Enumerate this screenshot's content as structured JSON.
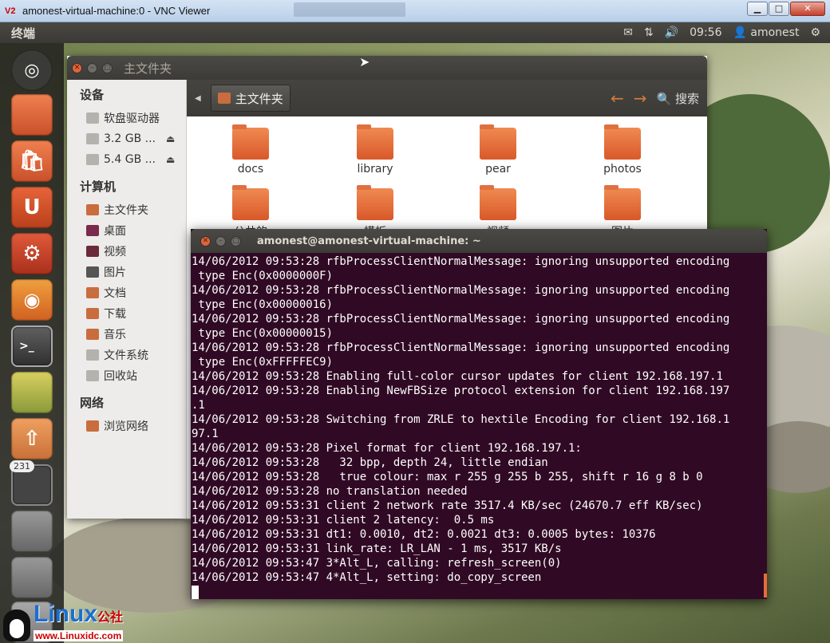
{
  "vnc": {
    "title": "amonest-virtual-machine:0 - VNC Viewer",
    "logo": "V2",
    "minimize": "▁",
    "maximize": "□",
    "close": "✕"
  },
  "panel": {
    "app_name": "终端",
    "time": "09:56",
    "user": "amonest",
    "icons": [
      "mail-icon",
      "network-icon",
      "volume-icon",
      "gear-icon"
    ]
  },
  "launcher": {
    "badge": "231",
    "items": [
      "dash",
      "home-folder",
      "software-center",
      "ubuntu-one",
      "system-settings",
      "firefox",
      "terminal",
      "disk-utility",
      "update-manager",
      "workspace-switcher",
      "drive",
      "drive",
      "trash"
    ]
  },
  "nautilus": {
    "title": "主文件夹",
    "crumb": "主文件夹",
    "search": "搜索",
    "devices_heading": "设备",
    "devices": [
      {
        "label": "软盘驱动器",
        "eject": false
      },
      {
        "label": "3.2 GB ...",
        "eject": true
      },
      {
        "label": "5.4 GB ...",
        "eject": true
      }
    ],
    "computer_heading": "计算机",
    "computer": [
      "主文件夹",
      "桌面",
      "视频",
      "图片",
      "文档",
      "下载",
      "音乐",
      "文件系统",
      "回收站"
    ],
    "network_heading": "网络",
    "network": [
      "浏览网络"
    ],
    "folders": [
      "docs",
      "library",
      "pear",
      "photos",
      "公共的",
      "模板",
      "视频",
      "图片"
    ]
  },
  "terminal": {
    "title": "amonest@amonest-virtual-machine: ~",
    "lines": [
      "14/06/2012 09:53:28 rfbProcessClientNormalMessage: ignoring unsupported encoding",
      " type Enc(0x0000000F)",
      "14/06/2012 09:53:28 rfbProcessClientNormalMessage: ignoring unsupported encoding",
      " type Enc(0x00000016)",
      "14/06/2012 09:53:28 rfbProcessClientNormalMessage: ignoring unsupported encoding",
      " type Enc(0x00000015)",
      "14/06/2012 09:53:28 rfbProcessClientNormalMessage: ignoring unsupported encoding",
      " type Enc(0xFFFFFEC9)",
      "14/06/2012 09:53:28 Enabling full-color cursor updates for client 192.168.197.1",
      "14/06/2012 09:53:28 Enabling NewFBSize protocol extension for client 192.168.197",
      ".1",
      "14/06/2012 09:53:28 Switching from ZRLE to hextile Encoding for client 192.168.1",
      "97.1",
      "14/06/2012 09:53:28 Pixel format for client 192.168.197.1:",
      "14/06/2012 09:53:28   32 bpp, depth 24, little endian",
      "14/06/2012 09:53:28   true colour: max r 255 g 255 b 255, shift r 16 g 8 b 0",
      "14/06/2012 09:53:28 no translation needed",
      "14/06/2012 09:53:31 client 2 network rate 3517.4 KB/sec (24670.7 eff KB/sec)",
      "14/06/2012 09:53:31 client 2 latency:  0.5 ms",
      "14/06/2012 09:53:31 dt1: 0.0010, dt2: 0.0021 dt3: 0.0005 bytes: 10376",
      "14/06/2012 09:53:31 link_rate: LR_LAN - 1 ms, 3517 KB/s",
      "14/06/2012 09:53:47 3*Alt_L, calling: refresh_screen(0)",
      "14/06/2012 09:53:47 4*Alt_L, setting: do_copy_screen"
    ]
  },
  "watermark": {
    "brand": "Linux",
    "suffix": "公社",
    "url": "www.Linuxidc.com"
  }
}
